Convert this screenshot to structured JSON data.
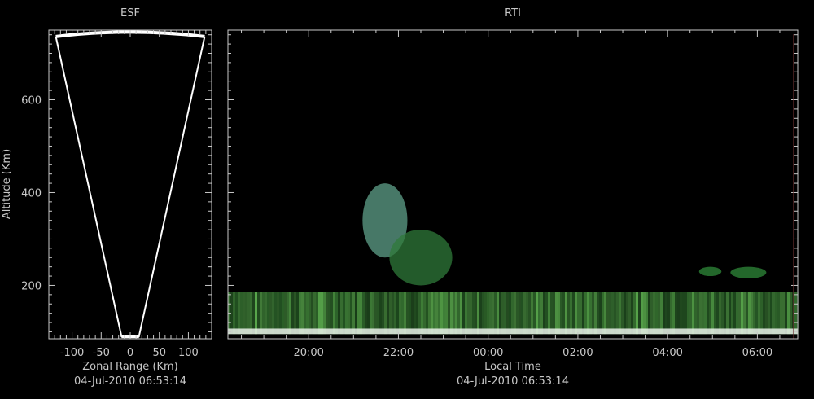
{
  "chart_data": [
    {
      "type": "heatmap",
      "title": "ESF",
      "xlabel": "Zonal Range (Km)",
      "ylabel": "Altitude (Km)",
      "timestamp": "04-Jul-2010 06:53:14",
      "xlim": [
        -140,
        140
      ],
      "ylim": [
        85,
        750
      ],
      "xticks": [
        -100,
        -50,
        0,
        50,
        100
      ],
      "xtick_labels": [
        "-100",
        "-50",
        "0",
        "50",
        "100"
      ],
      "yticks": [
        200,
        400,
        600
      ],
      "ytick_labels": [
        "200",
        "400",
        "600"
      ],
      "beam": {
        "arc_altitude_km": 745,
        "apex_altitude_km": 90,
        "left_edge_km": -128,
        "right_edge_km": 128,
        "apex_half_width_km": 15
      },
      "colors": {
        "outline": "#ffffff",
        "axes": "#c8c8c8",
        "background": "#000000"
      }
    },
    {
      "type": "heatmap",
      "title": "RTI",
      "xlabel": "Local Time",
      "timestamp": "04-Jul-2010 06:53:14",
      "xlim_hours": [
        18.2,
        30.9
      ],
      "ylim": [
        85,
        750
      ],
      "xticks_hours": [
        20,
        22,
        24,
        26,
        28,
        30
      ],
      "xtick_labels": [
        "20:00",
        "22:00",
        "00:00",
        "02:00",
        "04:00",
        "06:00"
      ],
      "yticks": [
        200,
        400,
        600
      ],
      "echo_regions": [
        {
          "name": "e-region-band",
          "t_start": 18.2,
          "t_end": 30.9,
          "alt_low": 95,
          "alt_high": 185,
          "color": "#3c7a3c"
        },
        {
          "name": "bright-base-layer",
          "t_start": 18.2,
          "t_end": 30.9,
          "alt_low": 95,
          "alt_high": 107,
          "color": "#e8f0e8"
        },
        {
          "name": "plume-main",
          "t_start": 21.2,
          "t_end": 22.2,
          "alt_low": 260,
          "alt_high": 420,
          "color": "#5fa08a"
        },
        {
          "name": "plume-tail",
          "t_start": 21.8,
          "t_end": 23.2,
          "alt_low": 200,
          "alt_high": 320,
          "color": "#2f7a3a"
        },
        {
          "name": "late-echo-1",
          "t_start": 28.7,
          "t_end": 29.2,
          "alt_low": 220,
          "alt_high": 240,
          "color": "#2f8a3a"
        },
        {
          "name": "late-echo-2",
          "t_start": 29.4,
          "t_end": 30.2,
          "alt_low": 215,
          "alt_high": 240,
          "color": "#2f8a3a"
        }
      ],
      "colors": {
        "axes": "#c8c8c8",
        "background": "#000000"
      }
    }
  ]
}
